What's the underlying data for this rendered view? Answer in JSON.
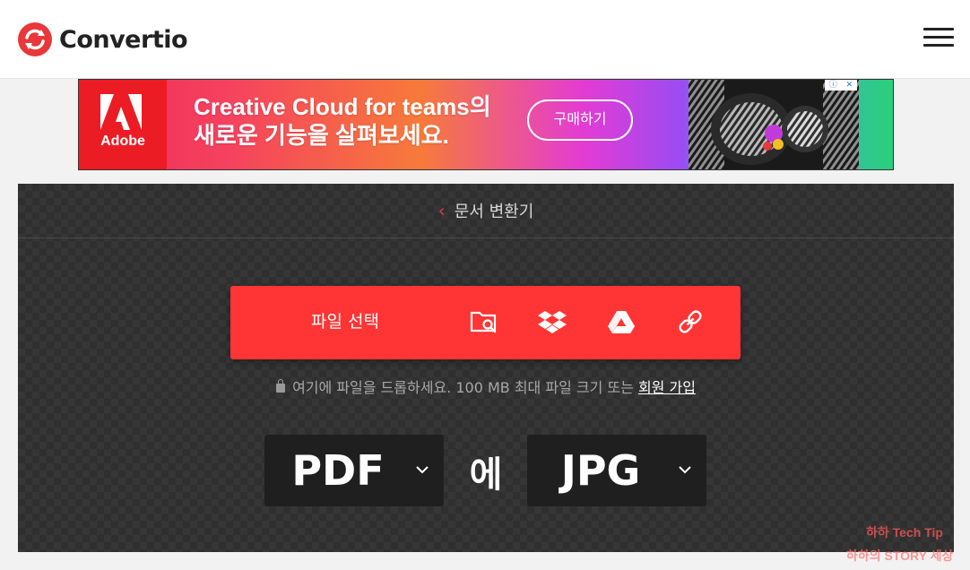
{
  "header": {
    "brand": "Convertio",
    "menu_icon": "hamburger-menu-icon",
    "brand_color": "#e8383b"
  },
  "ad": {
    "brand": "Adobe",
    "line1": "Creative Cloud for teams의",
    "line2": "새로운 기능을 살펴보세요.",
    "cta": "구매하기",
    "info_icon": "ad-info-icon",
    "close_icon": "ad-close-icon"
  },
  "converter": {
    "breadcrumb": "문서 변환기",
    "choose_label": "파일 선택",
    "sources": [
      "folder-search-icon",
      "dropbox-icon",
      "google-drive-icon",
      "link-icon"
    ],
    "hint": "여기에 파일을 드롭하세요. 100 MB 최대 파일 크기 또는",
    "signup_link": "회원 가입",
    "from_format": "PDF",
    "to_word": "에",
    "to_format": "JPG",
    "accent_color": "#ff3434"
  },
  "watermark": {
    "line1": "하하 Tech Tip",
    "line2": "하하의 STORY 세상"
  }
}
